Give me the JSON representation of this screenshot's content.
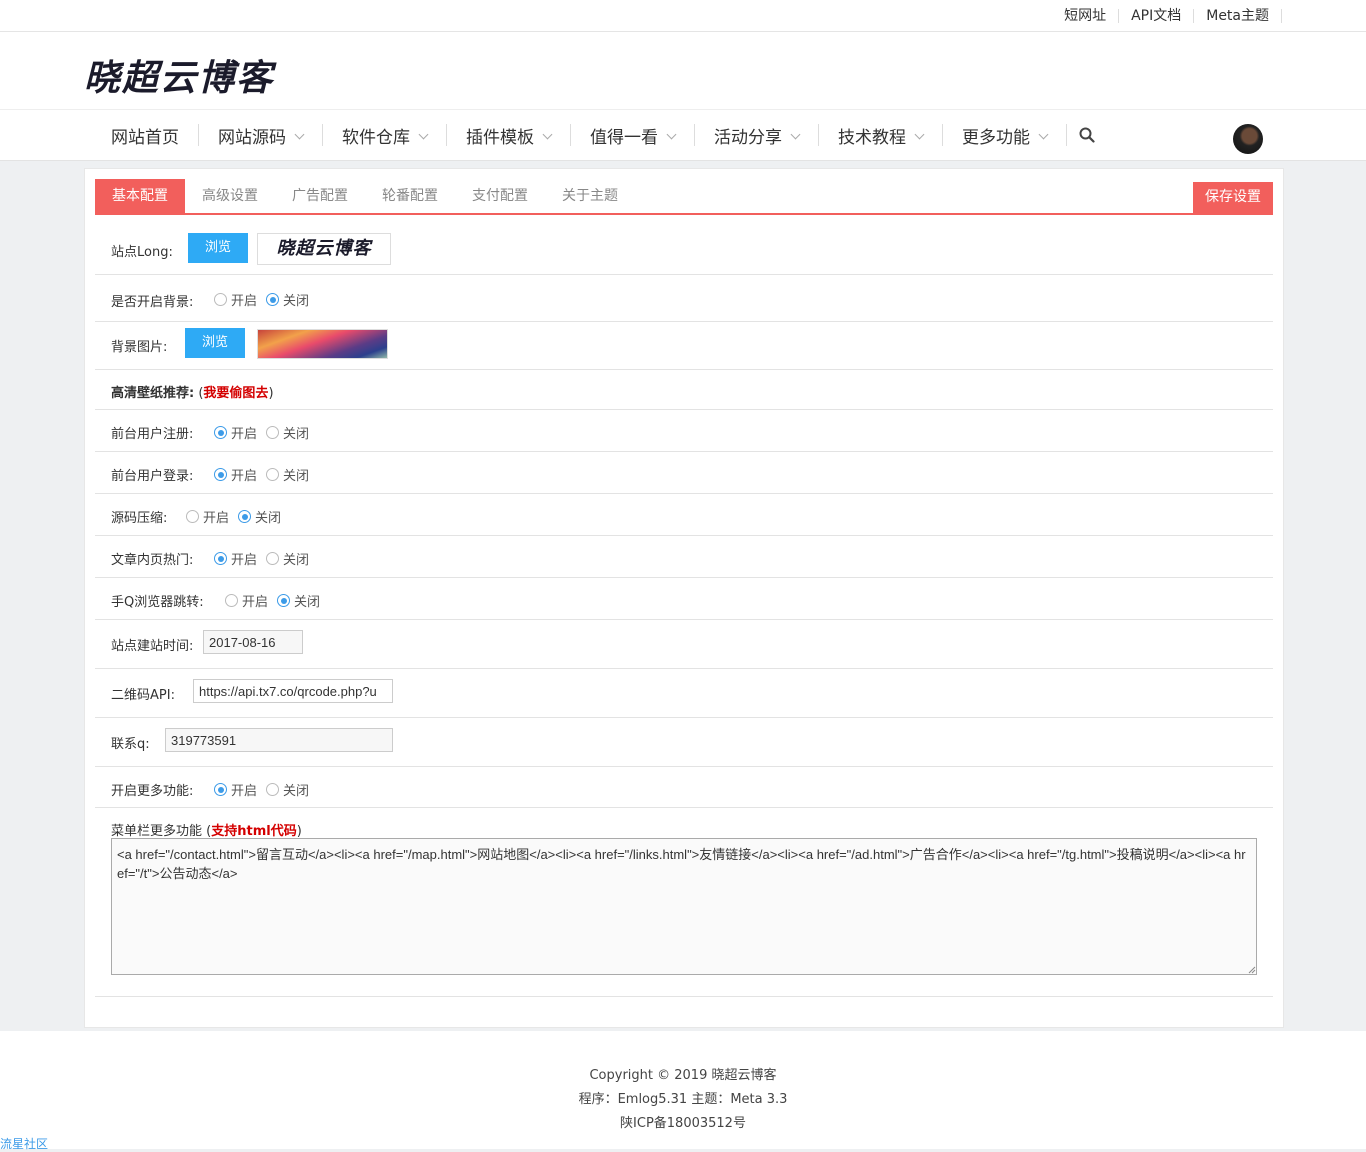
{
  "topbar": {
    "links": [
      "短网址",
      "API文档",
      "Meta主题"
    ]
  },
  "site": {
    "logo_text": "晓超云博客"
  },
  "nav": {
    "items": [
      "网站首页",
      "网站源码",
      "软件仓库",
      "插件模板",
      "值得一看",
      "活动分享",
      "技术教程",
      "更多功能"
    ]
  },
  "tabs": [
    "基本配置",
    "高级设置",
    "广告配置",
    "轮番配置",
    "支付配置",
    "关于主题"
  ],
  "save_label": "保存设置",
  "form": {
    "logo_label": "站点Long:",
    "browse": "浏览",
    "bg_enable_label": "是否开启背景:",
    "bg_image_label": "背景图片:",
    "wallpaper_label": "高清壁纸推荐:",
    "wallpaper_paren_open": " (",
    "wallpaper_link": "我要偷图去",
    "wallpaper_paren_close": ")",
    "reg_label": "前台用户注册:",
    "login_label": "前台用户登录:",
    "compress_label": "源码压缩:",
    "hot_label": "文章内页热门:",
    "qq_label": "手Q浏览器跳转:",
    "date_label": "站点建站时间:",
    "date_value": "2017-08-16",
    "qr_label": "二维码API:",
    "qr_value": "https://api.tx7.co/qrcode.php?u",
    "contact_label": "联系q:",
    "contact_value": "319773591",
    "more_label": "开启更多功能:",
    "menu_label": "菜单栏更多功能 (",
    "menu_html_note": "支持html代码",
    "menu_label_close": ")",
    "menu_value": "<a href=\"/contact.html\">留言互动</a><li><a href=\"/map.html\">网站地图</a><li><a href=\"/links.html\">友情链接</a><li><a href=\"/ad.html\">广告合作</a><li><a href=\"/tg.html\">投稿说明</a><li><a href=\"/t\">公告动态</a>",
    "on": "开启",
    "off": "关闭"
  },
  "radios": {
    "bg": "off",
    "reg": "on",
    "login": "on",
    "compress": "off",
    "hot": "on",
    "qq": "off",
    "more": "on"
  },
  "footer": {
    "copyright": "Copyright © 2019   晓超云博客",
    "program": "程序：Emlog5.31      主题：Meta 3.3",
    "icp": "陕ICP备18003512号"
  },
  "badge": "流星社区",
  "colors": {
    "accent": "#f25f5c",
    "button_blue": "#2eaaf5",
    "radio_blue": "#3c9be8"
  }
}
